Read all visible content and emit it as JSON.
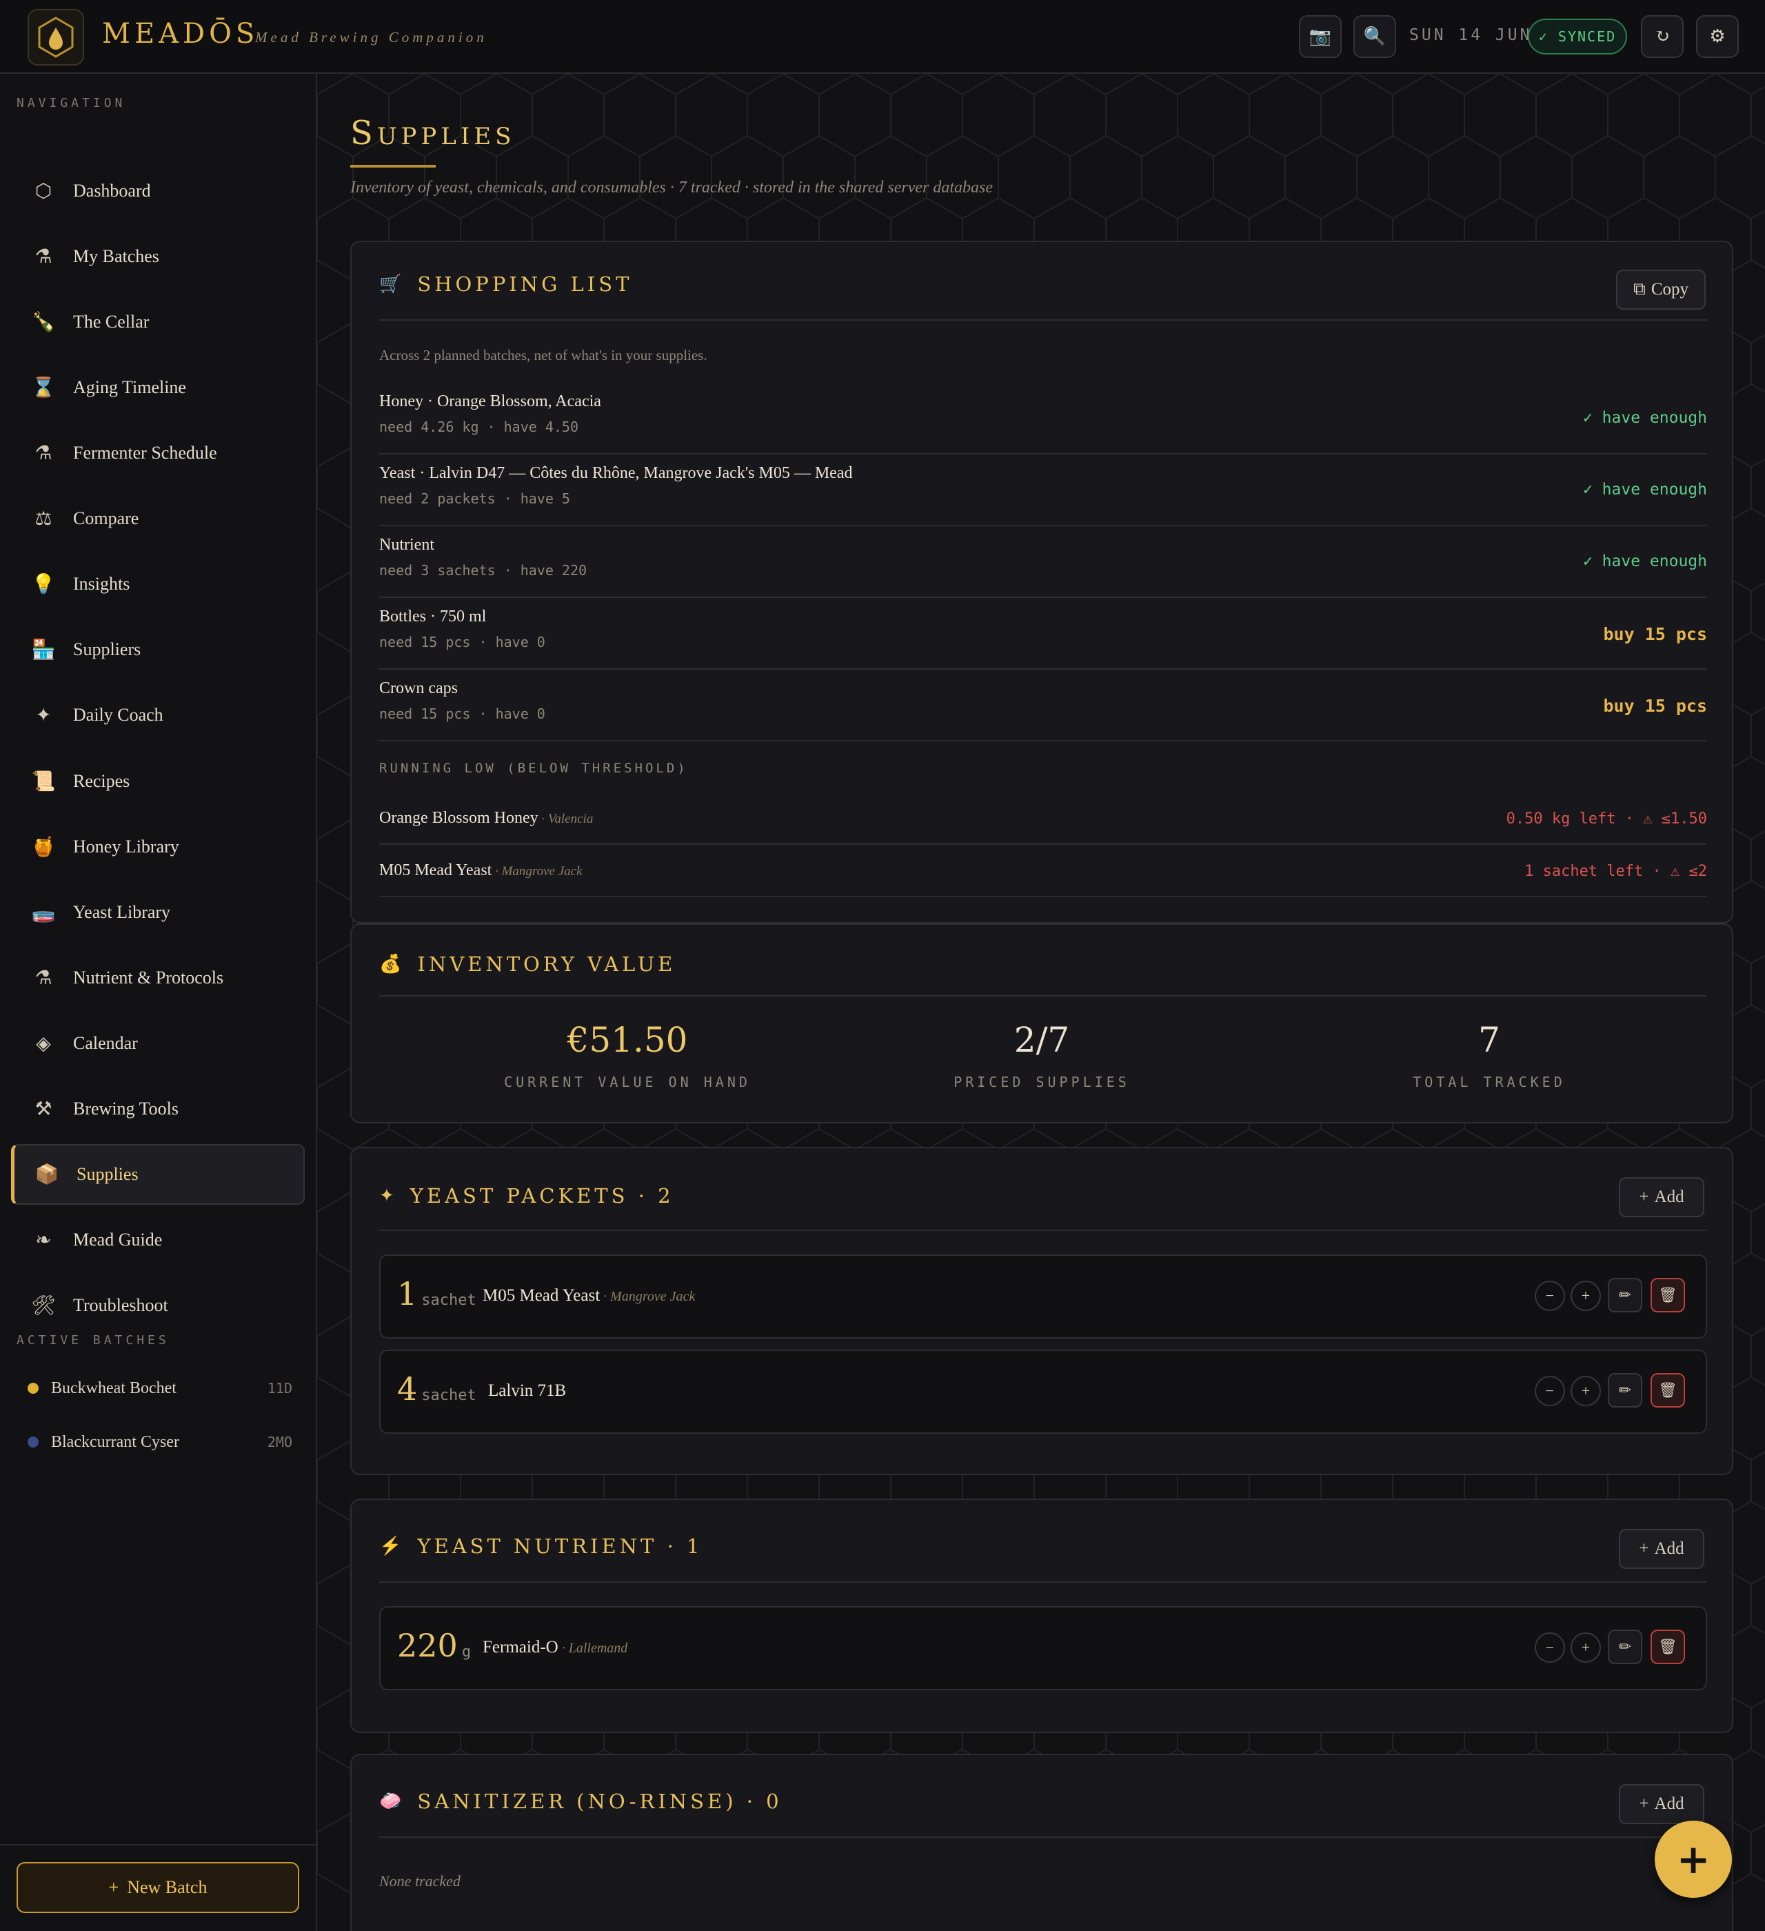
{
  "app": {
    "brand": "MEADŌS",
    "tagline": "Mead Brewing Companion",
    "date": "SUN 14 JUN",
    "sync_status": "✓ SYNCED"
  },
  "sidebar": {
    "nav_label": "NAVIGATION",
    "items": [
      {
        "label": "Dashboard",
        "icon": "⬡"
      },
      {
        "label": "My Batches",
        "icon": "⚗"
      },
      {
        "label": "The Cellar",
        "icon": "🍾"
      },
      {
        "label": "Aging Timeline",
        "icon": "⌛"
      },
      {
        "label": "Fermenter Schedule",
        "icon": "⚗"
      },
      {
        "label": "Compare",
        "icon": "⚖"
      },
      {
        "label": "Insights",
        "icon": "💡"
      },
      {
        "label": "Suppliers",
        "icon": "🏪"
      },
      {
        "label": "Daily Coach",
        "icon": "✦"
      },
      {
        "label": "Recipes",
        "icon": "📜"
      },
      {
        "label": "Honey Library",
        "icon": "🍯"
      },
      {
        "label": "Yeast Library",
        "icon": "🧫"
      },
      {
        "label": "Nutrient & Protocols",
        "icon": "⚗"
      },
      {
        "label": "Calendar",
        "icon": "◈"
      },
      {
        "label": "Brewing Tools",
        "icon": "⚒"
      },
      {
        "label": "Supplies",
        "icon": "📦"
      },
      {
        "label": "Mead Guide",
        "icon": "❧"
      },
      {
        "label": "Troubleshoot",
        "icon": "🛠"
      }
    ],
    "active_label": "ACTIVE BATCHES",
    "batches": [
      {
        "name": "Buckwheat Bochet",
        "age": "11D",
        "color": "#e0b030"
      },
      {
        "name": "Blackcurrant Cyser",
        "age": "2MO",
        "color": "#3a4a8a"
      }
    ],
    "new_batch": "New Batch"
  },
  "page": {
    "title": "Supplies",
    "subtitle": "Inventory of yeast, chemicals, and consumables · 7 tracked · stored in the shared server database"
  },
  "shopping": {
    "title": "SHOPPING LIST",
    "copy": "Copy",
    "summary": "Across 2 planned batches, net of what's in your supplies.",
    "rows": [
      {
        "name": "Honey · Orange Blossom, Acacia",
        "detail": "need 4.26 kg · have 4.50",
        "status": "✓ have enough"
      },
      {
        "name": "Yeast · Lalvin D47 — Côtes du Rhône, Mangrove Jack's M05 — Mead",
        "detail": "need 2 packets · have 5",
        "status": "✓ have enough"
      },
      {
        "name": "Nutrient",
        "detail": "need 3 sachets · have 220",
        "status": "✓ have enough"
      },
      {
        "name": "Bottles · 750 ml",
        "detail": "need 15 pcs · have 0",
        "status": "buy 15 pcs"
      },
      {
        "name": "Crown caps",
        "detail": "need 15 pcs · have 0",
        "status": "buy 15 pcs"
      }
    ],
    "low_label": "RUNNING LOW (BELOW THRESHOLD)",
    "low": [
      {
        "name": "Orange Blossom Honey",
        "supplier": " · Valencia",
        "status": "0.50 kg left · ⚠ ≤1.50"
      },
      {
        "name": "M05 Mead Yeast",
        "supplier": " · Mangrove Jack",
        "status": "1 sachet left · ⚠ ≤2"
      }
    ]
  },
  "value": {
    "title": "INVENTORY VALUE",
    "current": "€51.50",
    "current_label": "CURRENT VALUE ON HAND",
    "priced": "2/7",
    "priced_label": "PRICED SUPPLIES",
    "total": "7",
    "total_label": "TOTAL TRACKED"
  },
  "yeast": {
    "title": "YEAST PACKETS · 2",
    "add": "Add",
    "items": [
      {
        "qty": "1",
        "unit": "sachet",
        "name": "M05 Mead Yeast",
        "supplier": " · Mangrove Jack"
      },
      {
        "qty": "4",
        "unit": "sachet",
        "name": "Lalvin 71B",
        "supplier": ""
      }
    ]
  },
  "nutrient": {
    "title": "YEAST NUTRIENT · 1",
    "add": "Add",
    "items": [
      {
        "qty": "220",
        "unit": "g",
        "name": "Fermaid-O",
        "supplier": " · Lallemand"
      }
    ]
  },
  "sanitizer": {
    "title": "SANITIZER (NO-RINSE) · 0",
    "add": "Add",
    "empty": "None tracked"
  }
}
